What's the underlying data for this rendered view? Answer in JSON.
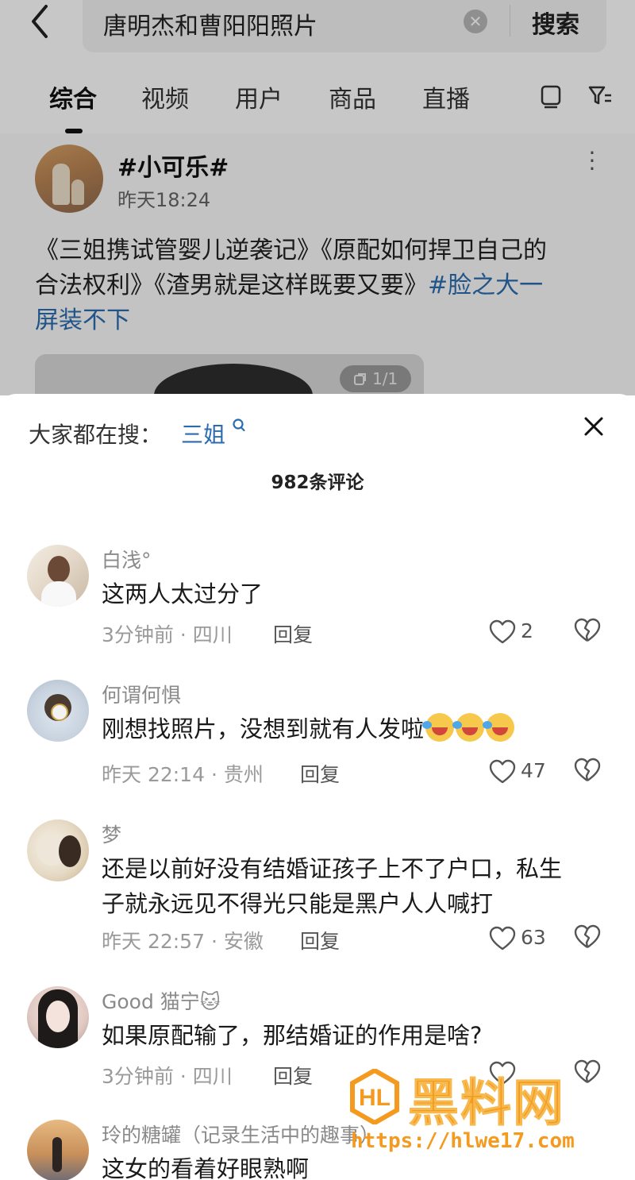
{
  "search": {
    "query": "唐明杰和曹阳阳照片",
    "button_label": "搜索"
  },
  "tabs": [
    {
      "label": "综合",
      "active": true
    },
    {
      "label": "视频",
      "active": false
    },
    {
      "label": "用户",
      "active": false
    },
    {
      "label": "商品",
      "active": false
    },
    {
      "label": "直播",
      "active": false
    }
  ],
  "post": {
    "username": "#小可乐#",
    "time": "昨天18:24",
    "text_line1": "《三姐携试管婴儿逆袭记》《原配如何捍卫自己的",
    "text_line2": "合法权利》《渣男就是这样既要又要》",
    "tag_part1": "#脸之大一",
    "tag_part2": "屏装不下",
    "media_badge": "1/1"
  },
  "sheet": {
    "hot_label": "大家都在搜：",
    "hot_term": "三姐",
    "comment_count": "982条评论"
  },
  "comments": [
    {
      "name": "白浅°",
      "text": "这两人太过分了",
      "time": "3分钟前",
      "location": "四川",
      "reply": "回复",
      "likes": "2"
    },
    {
      "name": "何谓何惧",
      "text": "刚想找照片，没想到就有人发啦",
      "time": "昨天 22:14",
      "location": "贵州",
      "reply": "回复",
      "likes": "47"
    },
    {
      "name": "梦",
      "text_line1": "还是以前好没有结婚证孩子上不了户口，私生",
      "text_line2": "子就永远见不得光只能是黑户人人喊打",
      "time": "昨天 22:57",
      "location": "安徽",
      "reply": "回复",
      "likes": "63"
    },
    {
      "name": "Good 猫宁🐱",
      "text": "如果原配输了，那结婚证的作用是啥?",
      "time": "3分钟前",
      "location": "四川",
      "reply": "回复",
      "likes": ""
    },
    {
      "name": "玲的糖罐（记录生活中的趣事）",
      "text": "这女的看着好眼熟啊",
      "time": "",
      "location": "",
      "reply": "",
      "likes": ""
    }
  ],
  "meta_separator": " · ",
  "watermark": {
    "title": "黑料网",
    "url": "https://hlwe17.com"
  },
  "colors": {
    "link": "#2b6cb0",
    "watermark": "#f39a1f"
  }
}
